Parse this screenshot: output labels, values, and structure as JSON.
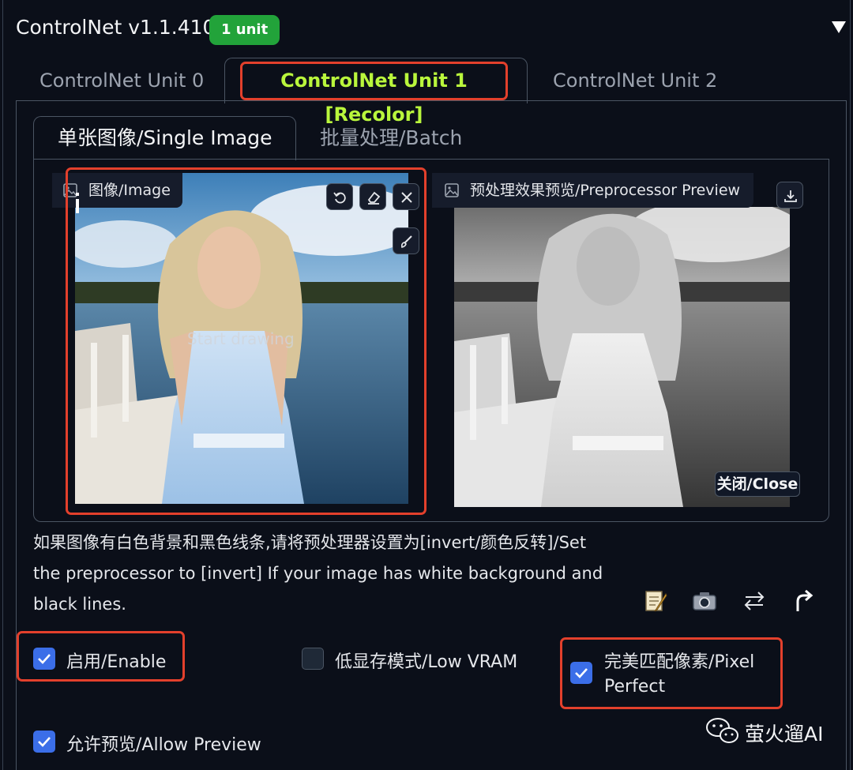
{
  "header": {
    "title": "ControlNet v1.1.410",
    "badge": "1 unit",
    "collapse_icon": "triangle-down-icon"
  },
  "tabs": [
    {
      "label": "ControlNet Unit 0",
      "active": false
    },
    {
      "label": "ControlNet Unit 1 [Recolor]",
      "active": true
    },
    {
      "label": "ControlNet Unit 2",
      "active": false
    }
  ],
  "inner_tabs": [
    {
      "label": "单张图像/Single Image",
      "active": true
    },
    {
      "label": "批量处理/Batch",
      "active": false
    }
  ],
  "image_input": {
    "label": "图像/Image",
    "overlay_text": "Start drawing",
    "tools": [
      "undo-icon",
      "eraser-icon",
      "close-icon",
      "brush-icon"
    ]
  },
  "preview": {
    "label": "预处理效果预览/Preprocessor Preview",
    "close_label": "关闭/Close",
    "download_icon": "download-icon"
  },
  "hint": "如果图像有白色背景和黑色线条,请将预处理器设置为[invert/颜色反转]/Set the preprocessor to [invert] If your image has white background and black lines.",
  "actions": [
    "edit-icon",
    "camera-icon",
    "swap-icon",
    "upload-arrow-icon"
  ],
  "options": {
    "enable": {
      "label": "启用/Enable",
      "checked": true
    },
    "low_vram": {
      "label": "低显存模式/Low VRAM",
      "checked": false
    },
    "pixel_perfect": {
      "label_line1": "完美匹配像素/Pixel",
      "label_line2": "Perfect",
      "checked": true
    },
    "allow_preview": {
      "label": "允许预览/Allow Preview",
      "checked": true
    }
  },
  "watermark": {
    "text": "萤火遛AI",
    "icon": "wechat-icon"
  },
  "colors": {
    "background": "#0b0f19",
    "highlight": "#e3402c",
    "active_tab": "#b9f63c",
    "badge": "#22a33a",
    "checkbox": "#3b6ee8"
  }
}
